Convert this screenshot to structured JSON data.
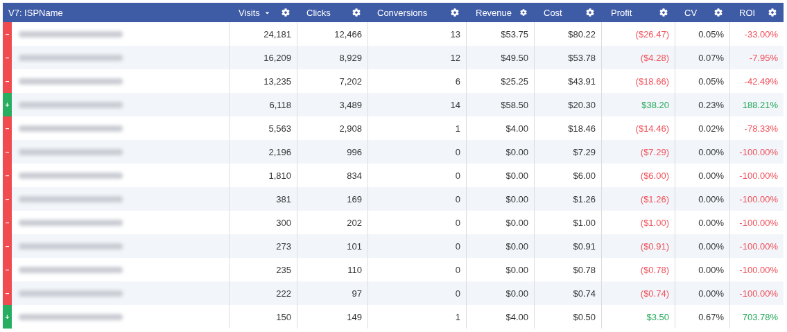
{
  "table": {
    "columns": [
      {
        "label": "V7: ISPName",
        "sorted": false,
        "settings": false
      },
      {
        "label": "Visits",
        "sorted": true,
        "settings": true
      },
      {
        "label": "Clicks",
        "sorted": false,
        "settings": true
      },
      {
        "label": "Conversions",
        "sorted": false,
        "settings": true
      },
      {
        "label": "Revenue",
        "sorted": false,
        "settings": true
      },
      {
        "label": "Cost",
        "sorted": false,
        "settings": true
      },
      {
        "label": "Profit",
        "sorted": false,
        "settings": true
      },
      {
        "label": "CV",
        "sorted": false,
        "settings": true
      },
      {
        "label": "ROI",
        "sorted": false,
        "settings": true
      }
    ],
    "rows": [
      {
        "kind": "down",
        "sign": "–",
        "cells": [
          "24,181",
          "12,466",
          "13",
          "$53.75",
          "$80.22",
          "($26.47)",
          "0.05%",
          "-33.00%"
        ]
      },
      {
        "kind": "down",
        "sign": "–",
        "cells": [
          "16,209",
          "8,929",
          "12",
          "$49.50",
          "$53.78",
          "($4.28)",
          "0.07%",
          "-7.95%"
        ]
      },
      {
        "kind": "down",
        "sign": "–",
        "cells": [
          "13,235",
          "7,202",
          "6",
          "$25.25",
          "$43.91",
          "($18.66)",
          "0.05%",
          "-42.49%"
        ]
      },
      {
        "kind": "up",
        "sign": "+",
        "cells": [
          "6,118",
          "3,489",
          "14",
          "$58.50",
          "$20.30",
          "$38.20",
          "0.23%",
          "188.21%"
        ]
      },
      {
        "kind": "down",
        "sign": "–",
        "cells": [
          "5,563",
          "2,908",
          "1",
          "$4.00",
          "$18.46",
          "($14.46)",
          "0.02%",
          "-78.33%"
        ]
      },
      {
        "kind": "down",
        "sign": "–",
        "cells": [
          "2,196",
          "996",
          "0",
          "$0.00",
          "$7.29",
          "($7.29)",
          "0.00%",
          "-100.00%"
        ]
      },
      {
        "kind": "down",
        "sign": "–",
        "cells": [
          "1,810",
          "834",
          "0",
          "$0.00",
          "$6.00",
          "($6.00)",
          "0.00%",
          "-100.00%"
        ]
      },
      {
        "kind": "down",
        "sign": "–",
        "cells": [
          "381",
          "169",
          "0",
          "$0.00",
          "$1.26",
          "($1.26)",
          "0.00%",
          "-100.00%"
        ]
      },
      {
        "kind": "down",
        "sign": "–",
        "cells": [
          "300",
          "202",
          "0",
          "$0.00",
          "$1.00",
          "($1.00)",
          "0.00%",
          "-100.00%"
        ]
      },
      {
        "kind": "down",
        "sign": "–",
        "cells": [
          "273",
          "101",
          "0",
          "$0.00",
          "$0.91",
          "($0.91)",
          "0.00%",
          "-100.00%"
        ]
      },
      {
        "kind": "down",
        "sign": "–",
        "cells": [
          "235",
          "110",
          "0",
          "$0.00",
          "$0.78",
          "($0.78)",
          "0.00%",
          "-100.00%"
        ]
      },
      {
        "kind": "down",
        "sign": "–",
        "cells": [
          "222",
          "97",
          "0",
          "$0.00",
          "$0.74",
          "($0.74)",
          "0.00%",
          "-100.00%"
        ]
      },
      {
        "kind": "up",
        "sign": "+",
        "cells": [
          "150",
          "149",
          "1",
          "$4.00",
          "$0.50",
          "$3.50",
          "0.67%",
          "703.78%"
        ]
      }
    ]
  }
}
